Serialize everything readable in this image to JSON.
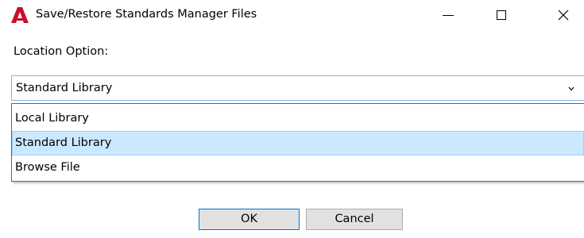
{
  "window": {
    "title": "Save/Restore Standards Manager Files",
    "app_icon": "autocad-a-icon",
    "accent_color": "#c8102e"
  },
  "controls": {
    "minimize_glyph": "minimize",
    "maximize_glyph": "maximize",
    "close_glyph": "✕"
  },
  "form": {
    "location_label": "Location Option:",
    "combo_value": "Standard Library",
    "options": [
      {
        "label": "Local Library",
        "selected": false
      },
      {
        "label": "Standard Library",
        "selected": true
      },
      {
        "label": "Browse File",
        "selected": false
      }
    ],
    "highlight_color": "#cce8ff"
  },
  "buttons": {
    "ok_label": "OK",
    "cancel_label": "Cancel"
  }
}
